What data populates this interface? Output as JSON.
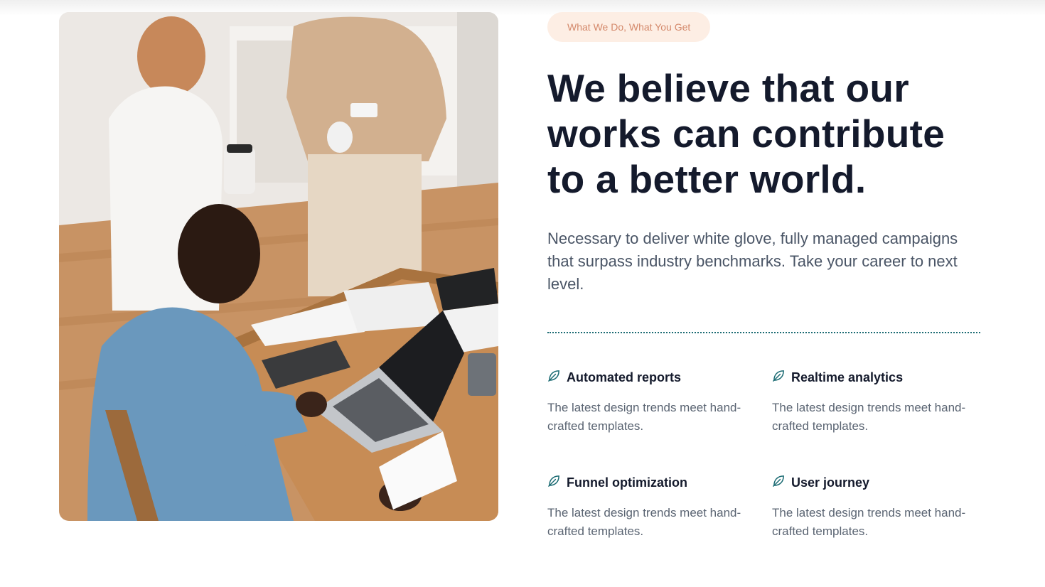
{
  "section": {
    "badge": "What We Do, What You Get",
    "headline": "We believe that our works can contribute to a better world.",
    "lead": "Necessary to deliver white glove, fully managed campaigns that surpass industry benchmarks. Take your career to next level."
  },
  "features": [
    {
      "icon": "leaf-icon",
      "title": "Automated reports",
      "description": "The latest design trends meet hand-crafted templates."
    },
    {
      "icon": "leaf-icon",
      "title": "Realtime analytics",
      "description": "The latest design trends meet hand-crafted templates."
    },
    {
      "icon": "leaf-icon",
      "title": "Funnel optimization",
      "description": "The latest design trends meet hand-crafted templates."
    },
    {
      "icon": "leaf-icon",
      "title": "User journey",
      "description": "The latest design trends meet hand-crafted templates."
    }
  ],
  "colors": {
    "heading": "#141a2c",
    "body_text": "#4a5566",
    "badge_bg": "#fdeee4",
    "badge_text": "#d4896b",
    "accent": "#1b6b73"
  }
}
